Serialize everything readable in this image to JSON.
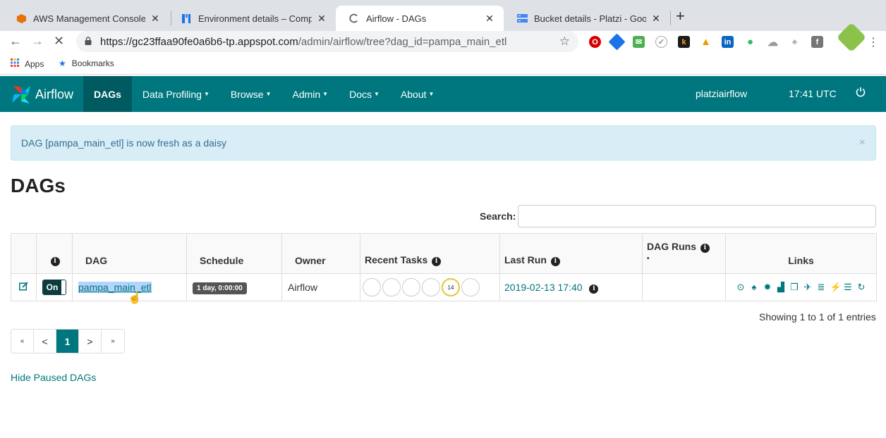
{
  "browser": {
    "tabs": [
      {
        "title": "AWS Management Console",
        "favicon": "aws-cube-icon",
        "color": "#ff9900"
      },
      {
        "title": "Environment details – Compose",
        "favicon": "composer-icon",
        "color": "#1a73e8"
      },
      {
        "title": "Airflow - DAGs",
        "favicon": "loading-spinner-icon",
        "color": "#5f6368"
      },
      {
        "title": "Bucket details - Platzi - Google",
        "favicon": "storage-bucket-icon",
        "color": "#4285f4"
      }
    ],
    "tab_close": "✕",
    "new_tab": "+",
    "url_host": "https://gc23ffaa90fe0a6b6-tp.appspot.com",
    "url_path": "/admin/airflow/tree?dag_id=pampa_main_etl",
    "bookmarks": [
      {
        "label": "Apps",
        "icon": "apps-grid-icon"
      },
      {
        "label": "Bookmarks",
        "icon": "star-icon"
      }
    ]
  },
  "navbar": {
    "brand": "Airflow",
    "items": [
      {
        "label": "DAGs",
        "active": true,
        "caret": false
      },
      {
        "label": "Data Profiling",
        "caret": true
      },
      {
        "label": "Browse",
        "caret": true
      },
      {
        "label": "Admin",
        "caret": true
      },
      {
        "label": "Docs",
        "caret": true
      },
      {
        "label": "About",
        "caret": true
      }
    ],
    "user": "platziairflow",
    "time": "17:41 UTC"
  },
  "alert": {
    "message": "DAG [pampa_main_etl] is now fresh as a daisy",
    "close": "×"
  },
  "page_title": "DAGs",
  "search": {
    "label": "Search:",
    "value": ""
  },
  "table": {
    "headers": {
      "info": "",
      "dag": "DAG",
      "schedule": "Schedule",
      "owner": "Owner",
      "recent_tasks": "Recent Tasks",
      "last_run": "Last Run",
      "dag_runs": "DAG Runs",
      "links": "Links"
    },
    "rows": [
      {
        "toggle": "On",
        "dag_id": "pampa_main_etl",
        "schedule": "1 day, 0:00:00",
        "owner": "Airflow",
        "recent_tasks": [
          "",
          "",
          "",
          "",
          "14",
          ""
        ],
        "last_run": "2019-02-13 17:40"
      }
    ]
  },
  "showing": "Showing 1 to 1 of 1 entries",
  "pagination": {
    "first": "«",
    "prev": "<",
    "current": "1",
    "next": ">",
    "last": "»"
  },
  "hide_paused": "Hide Paused DAGs",
  "colors": {
    "navbar": "#00777e",
    "alert_bg": "#d9edf7",
    "link": "#00777e"
  }
}
